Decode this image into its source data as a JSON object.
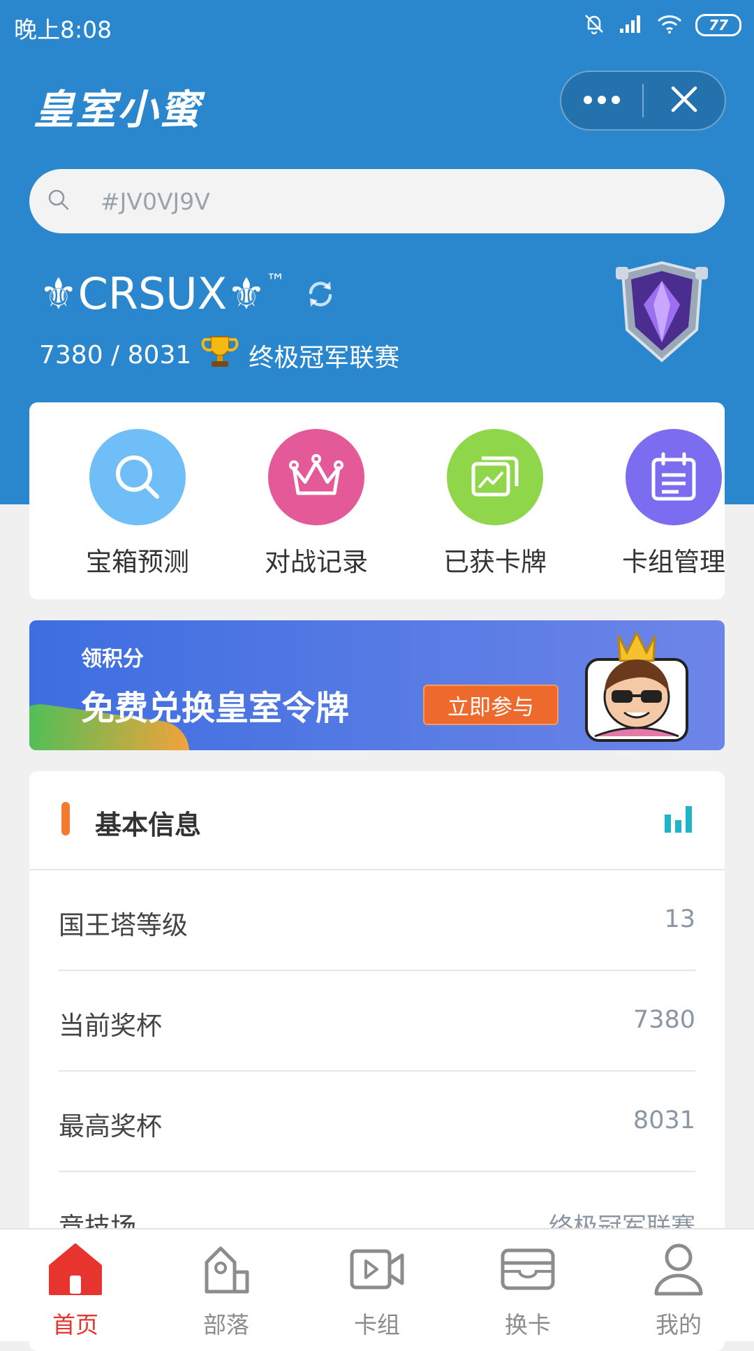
{
  "status_bar": {
    "time": "晚上8:08",
    "battery": "77"
  },
  "header": {
    "app_title": "皇室小蜜"
  },
  "search": {
    "placeholder": "#JV0VJ9V"
  },
  "player": {
    "name": "⚜CRSUX⚜",
    "tm": "™",
    "trophies": "7380 / 8031",
    "arena": "终极冠军联赛"
  },
  "menu": [
    {
      "label": "宝箱预测",
      "color": "#6fbef8",
      "icon": "search-icon"
    },
    {
      "label": "对战记录",
      "color": "#e45a99",
      "icon": "crown-icon"
    },
    {
      "label": "已获卡牌",
      "color": "#8fd64a",
      "icon": "cards-icon"
    },
    {
      "label": "卡组管理",
      "color": "#7b6cf0",
      "icon": "calendar-icon"
    }
  ],
  "banner": {
    "subtitle": "领积分",
    "title": "免费兑换皇室令牌",
    "button": "立即参与"
  },
  "basic_info": {
    "title": "基本信息",
    "rows": [
      {
        "label": "国王塔等级",
        "value": "13"
      },
      {
        "label": "当前奖杯",
        "value": "7380"
      },
      {
        "label": "最高奖杯",
        "value": "8031"
      },
      {
        "label": "竞技场",
        "value": "终极冠军联赛"
      }
    ]
  },
  "tabs": [
    {
      "label": "首页",
      "icon": "home-icon",
      "active": true
    },
    {
      "label": "部落",
      "icon": "clan-icon",
      "active": false
    },
    {
      "label": "卡组",
      "icon": "deck-video-icon",
      "active": false
    },
    {
      "label": "换卡",
      "icon": "wallet-icon",
      "active": false
    },
    {
      "label": "我的",
      "icon": "user-icon",
      "active": false
    }
  ],
  "colors": {
    "primary": "#2a87cd",
    "accent": "#f27b2e",
    "tab_active": "#e8342e"
  }
}
